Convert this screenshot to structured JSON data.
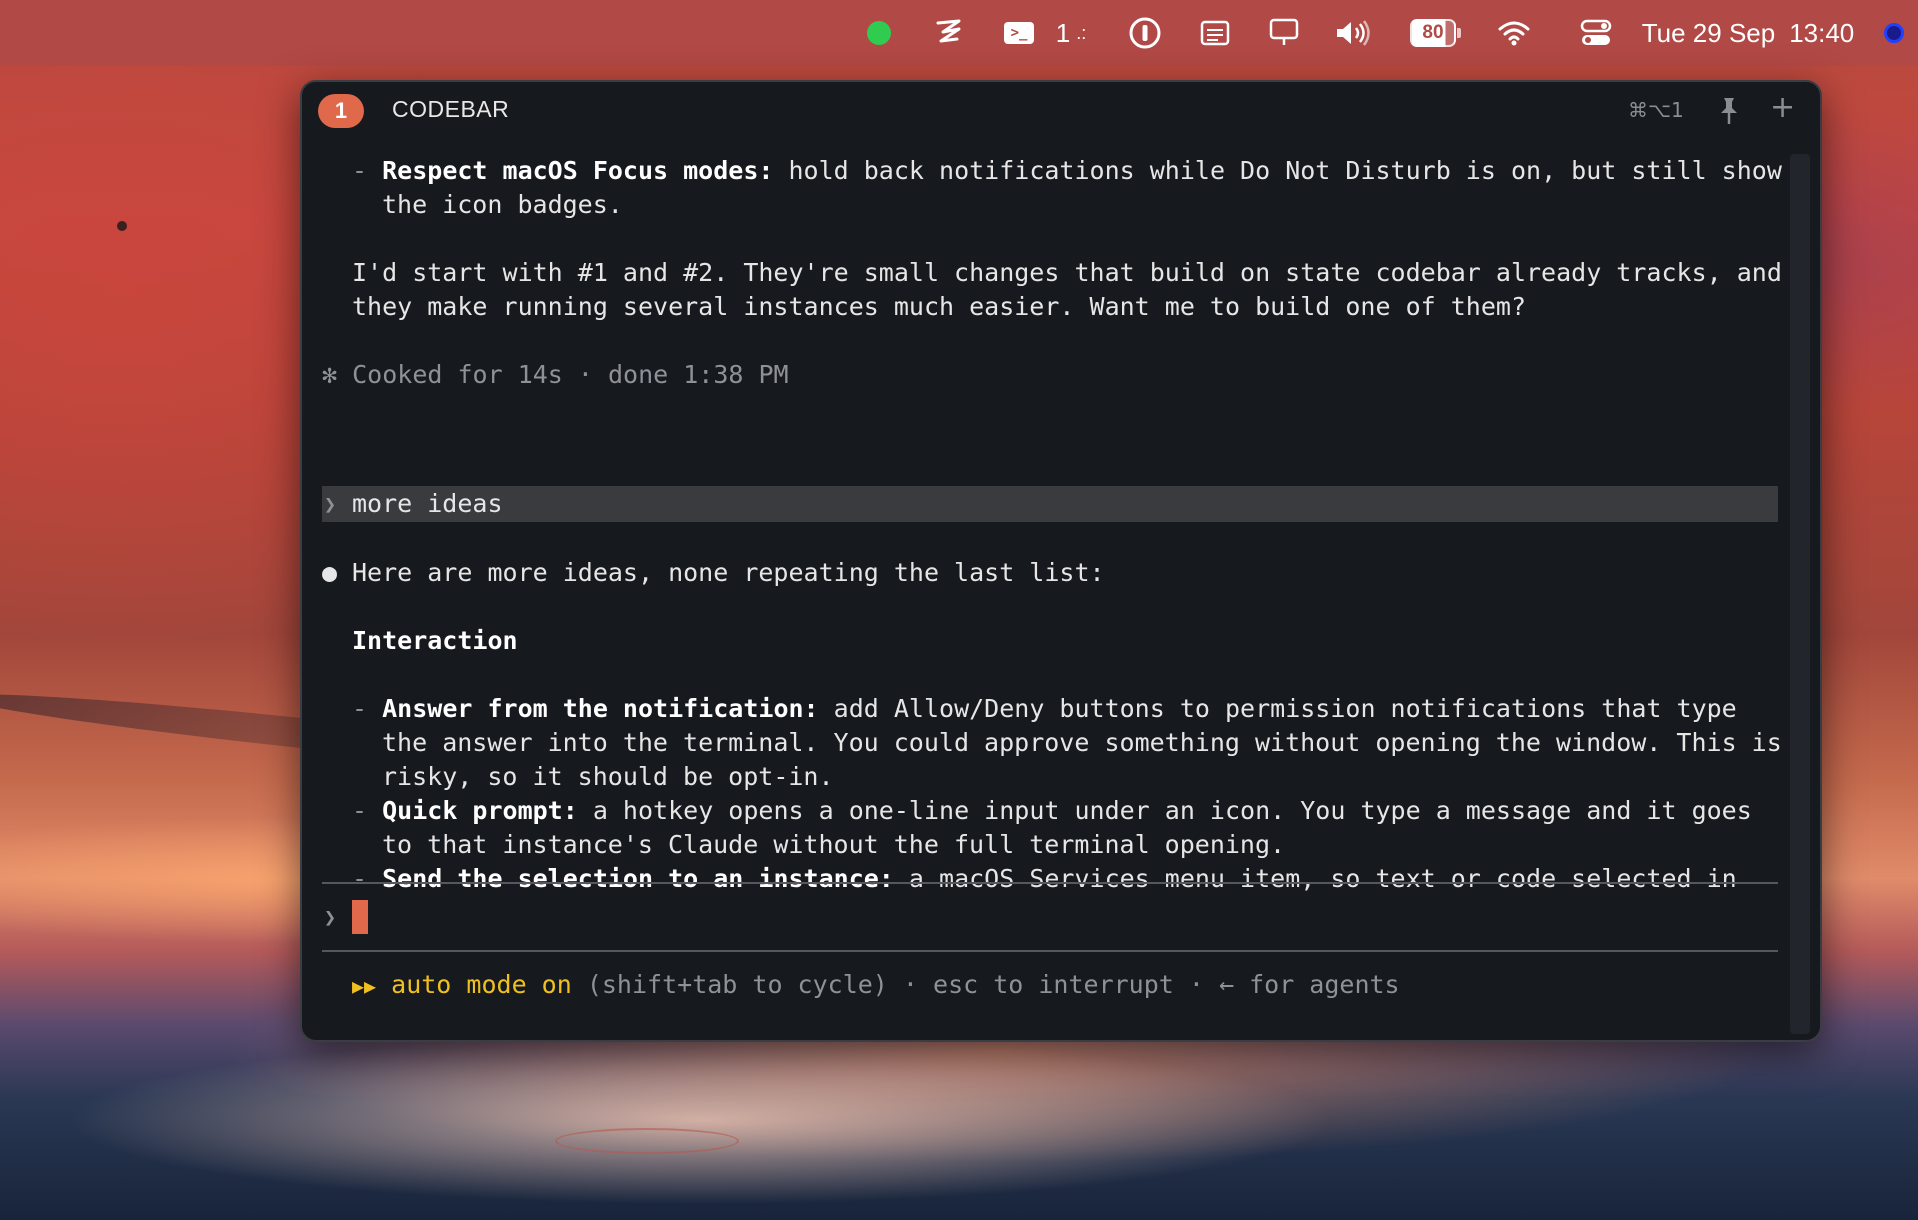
{
  "menubar": {
    "date": "Tue 29 Sep",
    "time": "13:40",
    "terminal_count": "1",
    "battery_level": "80",
    "icons": [
      "status-green-dot",
      "claude-logo-icon",
      "terminal-icon",
      "password-manager-icon",
      "document-icon",
      "display-icon",
      "volume-icon",
      "battery-icon",
      "wifi-icon",
      "control-center-icon",
      "siri-dot"
    ]
  },
  "window": {
    "tab_number": "1",
    "title": "CODEBAR",
    "shortcut": "⌘⌥1"
  },
  "transcript": {
    "focus_bullet_label": "Respect macOS Focus modes:",
    "focus_bullet_text_1": " hold back notifications while Do Not Disturb is on, but still show",
    "focus_bullet_text_2": "the icon badges.",
    "para_1": "I'd start with #1 and #2. They're small changes that build on state codebar already tracks, and",
    "para_2": "they make running several instances much easier. Want me to build one of them?",
    "status_glyph": "✻",
    "status": "Cooked for 14s · done 1:38 PM",
    "user_prompt_glyph": "❯",
    "user_prompt": "more ideas",
    "reply_intro": "Here are more ideas, none repeating the last list:",
    "section_heading": "Interaction",
    "items": [
      {
        "label": "Answer from the notification:",
        "lines": [
          " add Allow/Deny buttons to permission notifications that type",
          "the answer into the terminal. You could approve something without opening the window. This is",
          "risky, so it should be opt-in."
        ]
      },
      {
        "label": "Quick prompt:",
        "lines": [
          " a hotkey opens a one-line input under an icon. You type a message and it goes",
          "to that instance's Claude without the full terminal opening."
        ]
      },
      {
        "label": "Send the selection to an instance:",
        "lines": [
          " a macOS Services menu item, so text or code selected in"
        ]
      }
    ]
  },
  "input": {
    "prompt_glyph": "❯",
    "value": ""
  },
  "footer": {
    "mode_glyph": "▶▶",
    "mode": "auto mode on",
    "hint": " (shift+tab to cycle) · esc to interrupt · ← for agents"
  },
  "colors": {
    "accent": "#e0694c",
    "mode_yellow": "#f0c020",
    "window_bg": "#16191e"
  }
}
